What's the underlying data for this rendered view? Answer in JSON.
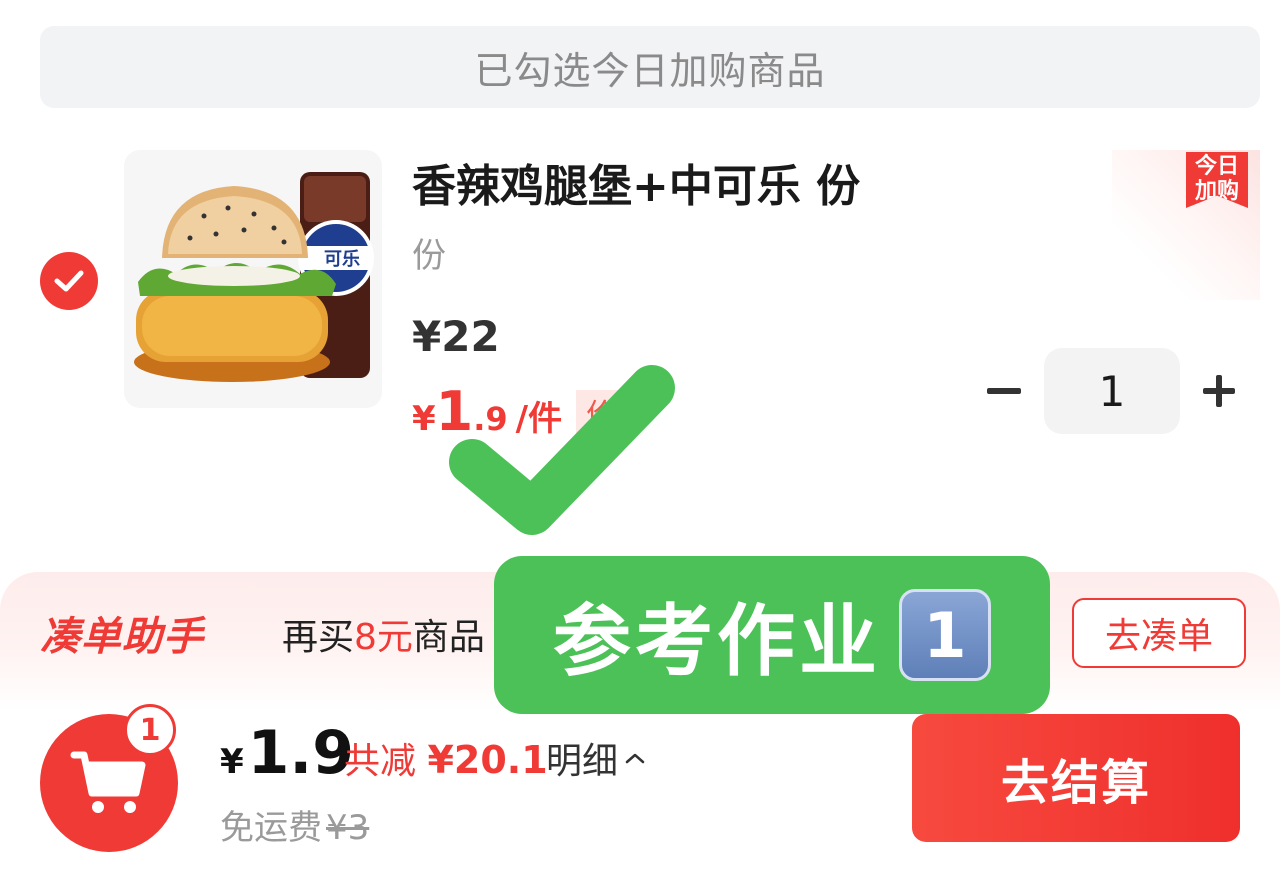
{
  "notice": {
    "text": "已勾选今日加购商品"
  },
  "item": {
    "checked": true,
    "title": "香辣鸡腿堡+中可乐 份",
    "spec": "份",
    "original_price": "¥22",
    "sale_price": {
      "currency": "¥",
      "integer": "1",
      "decimal": ".9",
      "unit": "/件"
    },
    "price_tag": "价",
    "badge": {
      "line1": "今日",
      "line2": "加购"
    },
    "quantity": "1",
    "image_text": "可乐"
  },
  "helper": {
    "logo": "凑单助手",
    "text_prefix": "再买",
    "text_highlight": "8元",
    "text_suffix": "商品 可",
    "button": "去凑单"
  },
  "watermark": {
    "text": "参考作业",
    "number": "1"
  },
  "bottom": {
    "cart_count": "1",
    "currency": "¥",
    "total": "1.9",
    "discount_label": "共减",
    "discount_amount": "¥20.1",
    "detail": "明细",
    "shipping_label": "免运费",
    "shipping_original": "¥3",
    "checkout": "去结算"
  },
  "colors": {
    "accent": "#ef3a36",
    "watermark_green": "#4cc158"
  }
}
